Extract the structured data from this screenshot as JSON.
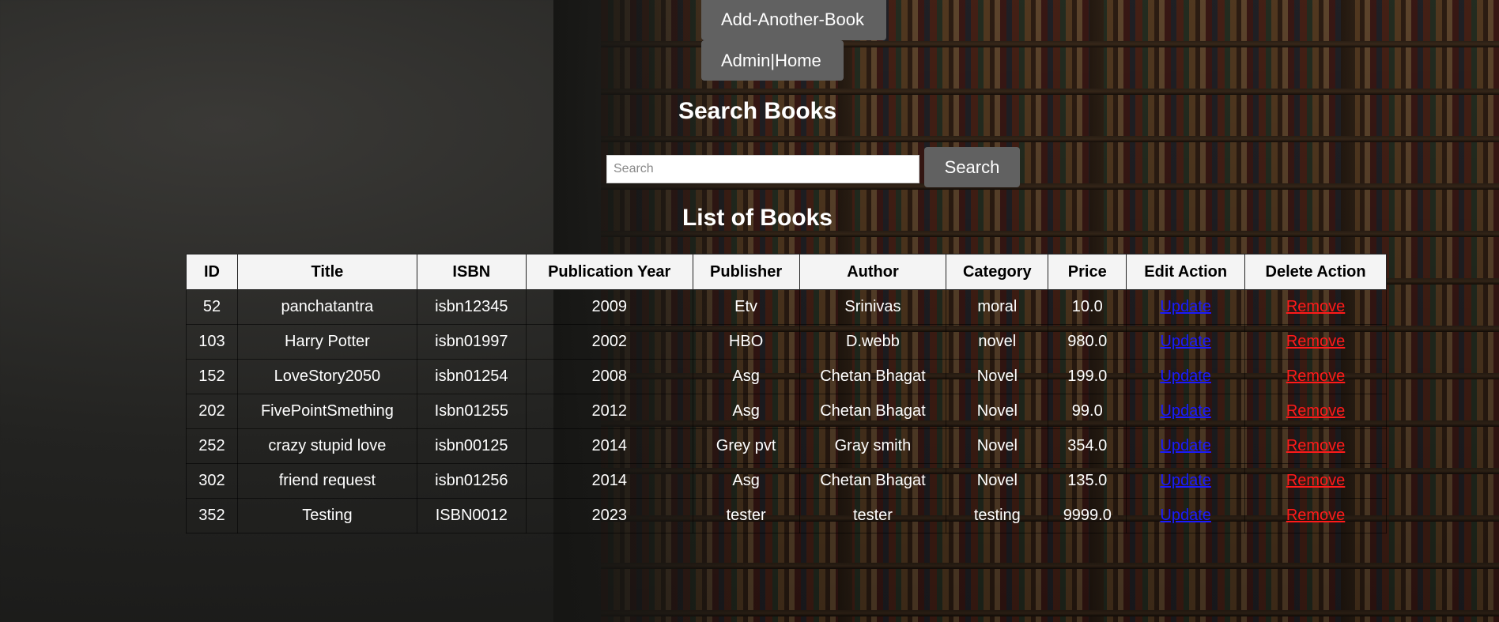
{
  "nav": {
    "add_book_label": "Add-Another-Book",
    "admin_home_label": "Admin|Home"
  },
  "search": {
    "heading": "Search Books",
    "placeholder": "Search",
    "value": "",
    "button_label": "Search"
  },
  "list": {
    "heading": "List of Books",
    "columns": [
      "ID",
      "Title",
      "ISBN",
      "Publication Year",
      "Publisher",
      "Author",
      "Category",
      "Price",
      "Edit Action",
      "Delete Action"
    ],
    "rows": [
      {
        "id": "52",
        "title": "panchatantra",
        "isbn": "isbn12345",
        "year": "2009",
        "publisher": "Etv",
        "author": "Srinivas",
        "category": "moral",
        "price": "10.0",
        "edit": "Update",
        "delete": "Remove"
      },
      {
        "id": "103",
        "title": "Harry Potter",
        "isbn": "isbn01997",
        "year": "2002",
        "publisher": "HBO",
        "author": "D.webb",
        "category": "novel",
        "price": "980.0",
        "edit": "Update",
        "delete": "Remove"
      },
      {
        "id": "152",
        "title": "LoveStory2050",
        "isbn": "isbn01254",
        "year": "2008",
        "publisher": "Asg",
        "author": "Chetan Bhagat",
        "category": "Novel",
        "price": "199.0",
        "edit": "Update",
        "delete": "Remove"
      },
      {
        "id": "202",
        "title": "FivePointSmething",
        "isbn": "Isbn01255",
        "year": "2012",
        "publisher": "Asg",
        "author": "Chetan Bhagat",
        "category": "Novel",
        "price": "99.0",
        "edit": "Update",
        "delete": "Remove"
      },
      {
        "id": "252",
        "title": "crazy stupid love",
        "isbn": "isbn00125",
        "year": "2014",
        "publisher": "Grey pvt",
        "author": "Gray smith",
        "category": "Novel",
        "price": "354.0",
        "edit": "Update",
        "delete": "Remove"
      },
      {
        "id": "302",
        "title": "friend request",
        "isbn": "isbn01256",
        "year": "2014",
        "publisher": "Asg",
        "author": "Chetan Bhagat",
        "category": "Novel",
        "price": "135.0",
        "edit": "Update",
        "delete": "Remove"
      },
      {
        "id": "352",
        "title": "Testing",
        "isbn": "ISBN0012",
        "year": "2023",
        "publisher": "tester",
        "author": "tester",
        "category": "testing",
        "price": "9999.0",
        "edit": "Update",
        "delete": "Remove"
      }
    ]
  },
  "colors": {
    "button_bg": "#616161",
    "update_link": "#1a1aff",
    "remove_link": "#ff1a1a",
    "header_bg": "#f4f4f4"
  }
}
